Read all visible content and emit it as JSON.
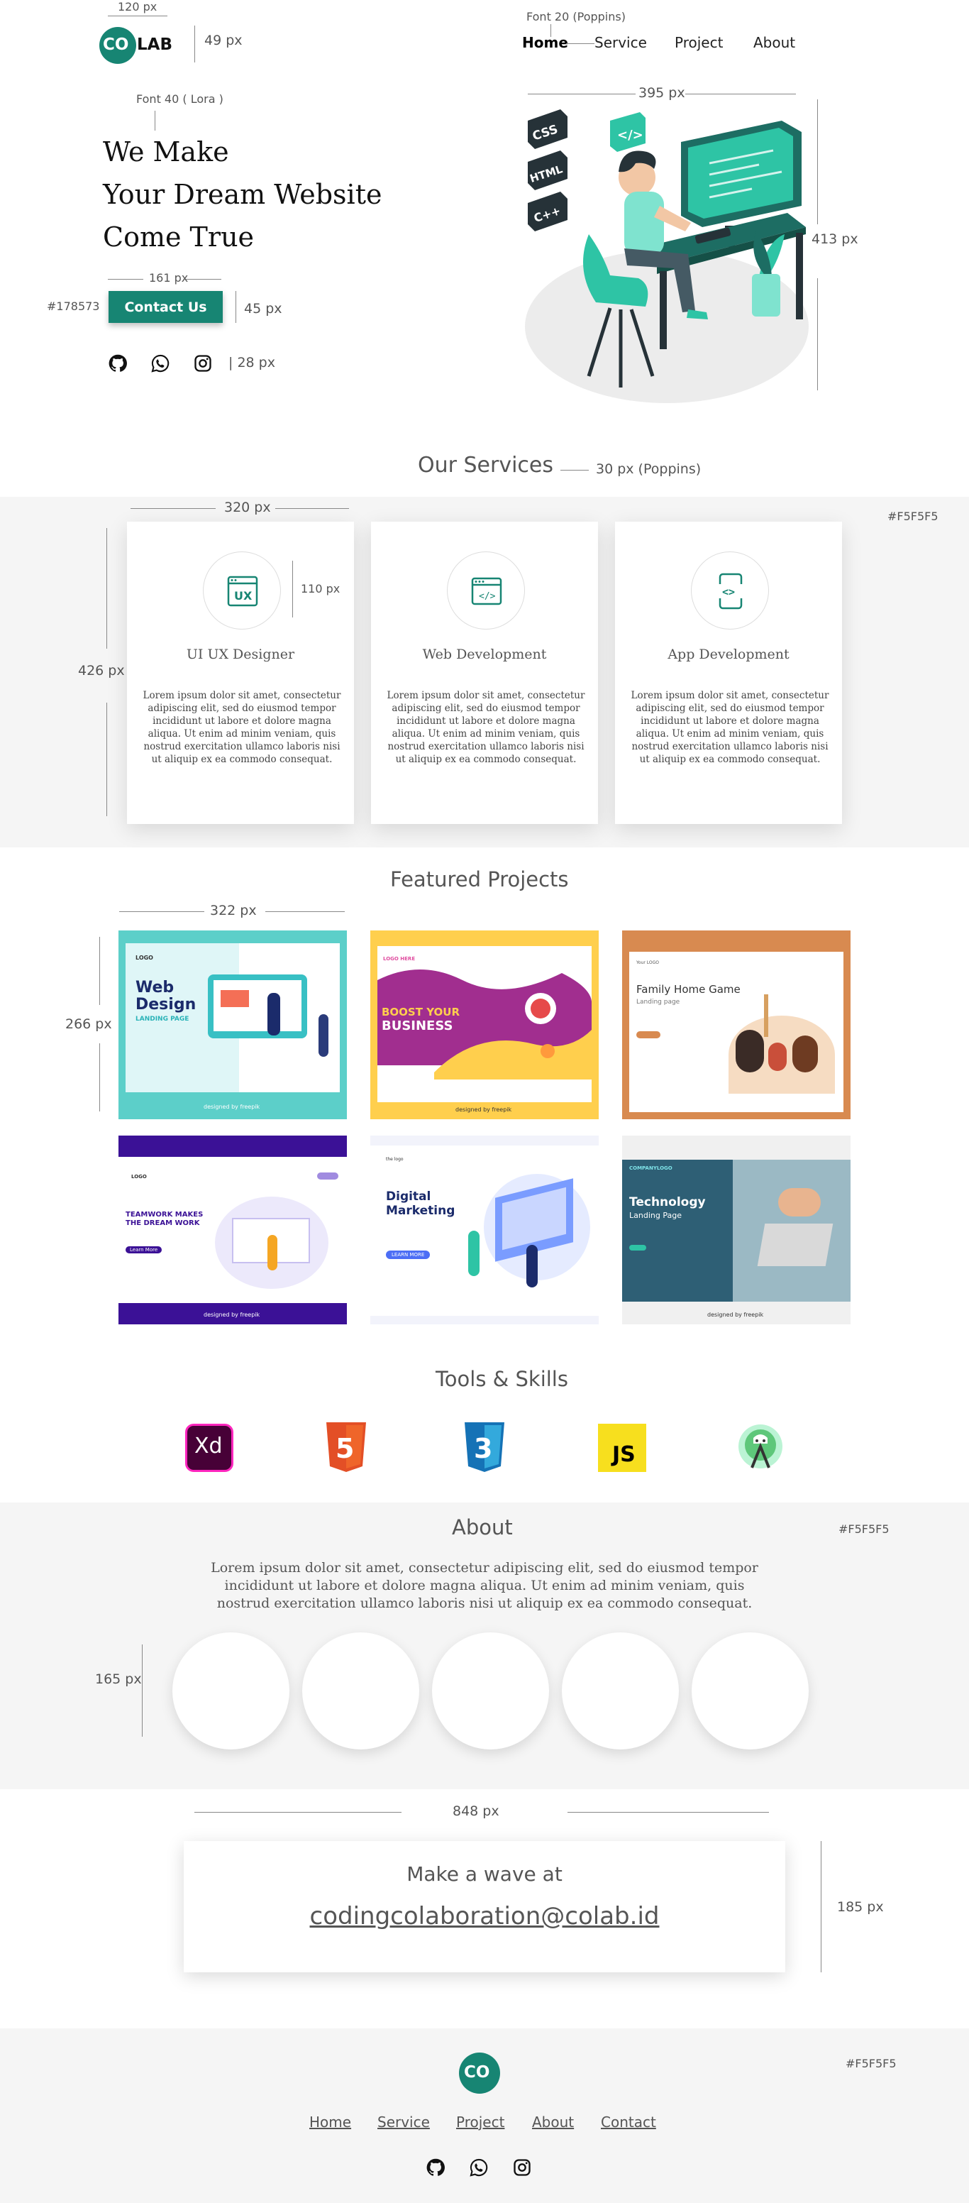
{
  "annotations": {
    "logo_width": "120 px",
    "logo_height": "49 px",
    "nav_font": "Font 20 (Poppins)",
    "hero_font": "Font 40 ( Lora )",
    "button_width": "161 px",
    "button_color": "#178573",
    "button_height": "45 px",
    "social_size": "| 28 px",
    "hero_image_width": "395 px",
    "hero_image_height": "413 px",
    "services_font": "30 px (Poppins)",
    "services_bg": "#F5F5F5",
    "card_width": "320 px",
    "card_height": "426 px",
    "icon_circle": "110 px",
    "project_width": "322 px",
    "project_height": "266 px",
    "about_bg": "#F5F5F5",
    "photo_size": "165 px",
    "contact_width": "848 px",
    "contact_height": "185 px",
    "footer_bg": "#F5F5F5"
  },
  "brand": {
    "logo_co": "CO",
    "logo_lab": "LAB",
    "primary": "#178573",
    "teal": "#2ec4a5"
  },
  "nav": {
    "home": "Home",
    "service": "Service",
    "project": "Project",
    "about": "About"
  },
  "hero": {
    "line1": "We Make",
    "line2": "Your Dream Website",
    "line3": "Come True",
    "cta": "Contact Us",
    "illustration_labels": {
      "css": "CSS",
      "html": "HTML",
      "cpp": "C++"
    }
  },
  "services": {
    "title": "Our Services",
    "cards": [
      {
        "title": "UI UX Designer",
        "icon": "ux-icon",
        "icon_text": "UX",
        "body": "Lorem ipsum dolor sit amet, consectetur adipiscing elit, sed do eiusmod tempor incididunt ut labore et dolore magna aliqua. Ut enim ad minim veniam, quis nostrud exercitation ullamco laboris nisi ut aliquip ex ea commodo consequat."
      },
      {
        "title": "Web Development",
        "icon": "web-code-icon",
        "icon_text": "</>",
        "body": "Lorem ipsum dolor sit amet, consectetur adipiscing elit, sed do eiusmod tempor incididunt ut labore et dolore magna aliqua. Ut enim ad minim veniam, quis nostrud exercitation ullamco laboris nisi ut aliquip ex ea commodo consequat."
      },
      {
        "title": "App Development",
        "icon": "mobile-code-icon",
        "icon_text": "<>",
        "body": "Lorem ipsum dolor sit amet, consectetur adipiscing elit, sed do eiusmod tempor incididunt ut labore et dolore magna aliqua. Ut enim ad minim veniam, quis nostrud exercitation ullamco laboris nisi ut aliquip ex ea commodo consequat."
      }
    ]
  },
  "projects": {
    "title": "Featured Projects",
    "items": [
      {
        "line1": "Web",
        "line2": "Design",
        "sub": "LANDING PAGE",
        "logo": "LOGO",
        "credit": "designed by freepik",
        "bg": "#5ccfc9"
      },
      {
        "line1": "BOOST YOUR",
        "line2": "BUSINESS",
        "sub": "",
        "logo": "LOGO HERE",
        "credit": "designed by freepik",
        "bg": "#ffcf4d"
      },
      {
        "line1": "Family Home Game",
        "line2": "",
        "sub": "Landing page",
        "logo": "Your LOGO",
        "credit": "",
        "bg": "#d88a50"
      },
      {
        "line1": "TEAMWORK MAKES",
        "line2": "THE DREAM WORK",
        "sub": "Learn More",
        "logo": "LOGO",
        "credit": "designed by freepik",
        "bg": "#3b1196"
      },
      {
        "line1": "Digital",
        "line2": "Marketing",
        "sub": "LEARN MORE",
        "logo": "the logo",
        "credit": "",
        "bg": "#f2f3fb"
      },
      {
        "line1": "Technology",
        "line2": "Landing Page",
        "sub": "",
        "logo": "COMPANYLOGO",
        "credit": "designed by freepik",
        "bg": "#2e5f75"
      }
    ]
  },
  "tools": {
    "title": "Tools & Skills",
    "items": [
      {
        "name": "adobe-xd-icon",
        "label": "Xd"
      },
      {
        "name": "html5-icon",
        "label": "5"
      },
      {
        "name": "css3-icon",
        "label": "3"
      },
      {
        "name": "javascript-icon",
        "label": "JS"
      },
      {
        "name": "android-studio-icon",
        "label": ""
      }
    ]
  },
  "about": {
    "title": "About",
    "body": "Lorem ipsum dolor sit amet, consectetur adipiscing elit, sed do eiusmod tempor incididunt ut labore et dolore magna aliqua. Ut enim ad minim veniam, quis nostrud exercitation ullamco laboris nisi ut aliquip ex ea commodo consequat."
  },
  "contact": {
    "heading": "Make a wave at",
    "email": "codingcolaboration@colab.id"
  },
  "footer": {
    "logo": "CO",
    "home": "Home",
    "service": "Service",
    "project": "Project",
    "about": "About",
    "contact": "Contact"
  }
}
